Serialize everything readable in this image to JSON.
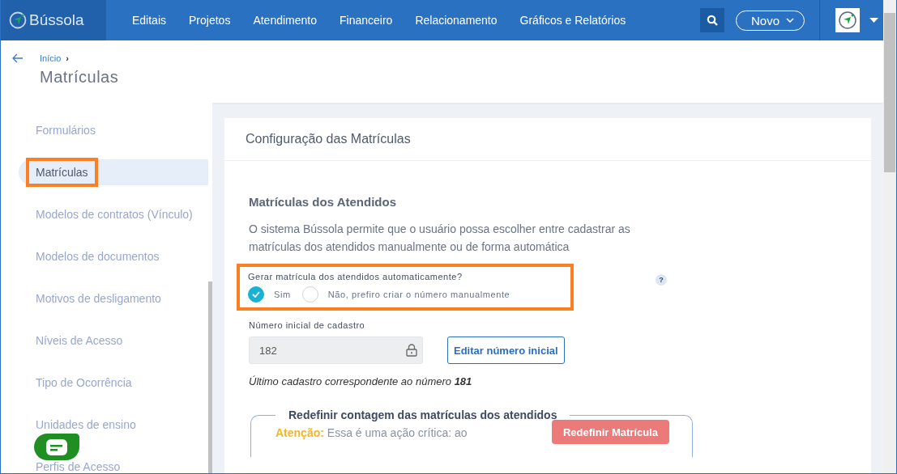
{
  "brand": "Bússola",
  "nav": [
    "Editais",
    "Projetos",
    "Atendimento",
    "Financeiro",
    "Relacionamento",
    "Gráficos e Relatórios"
  ],
  "new_button": "Novo",
  "breadcrumb": "Início",
  "breadcrumb_sep": "›",
  "page_title": "Matrículas",
  "sidebar": [
    {
      "label": "Formulários",
      "selected": false,
      "highlighted": false
    },
    {
      "label": "Matrículas",
      "selected": true,
      "highlighted": true
    },
    {
      "label": "Modelos de contratos (Vínculo)",
      "selected": false,
      "highlighted": false
    },
    {
      "label": "Modelos de documentos",
      "selected": false,
      "highlighted": false
    },
    {
      "label": "Motivos de desligamento",
      "selected": false,
      "highlighted": false
    },
    {
      "label": "Níveis de Acesso",
      "selected": false,
      "highlighted": false
    },
    {
      "label": "Tipo de Ocorrência",
      "selected": false,
      "highlighted": false
    },
    {
      "label": "Unidades de ensino",
      "selected": false,
      "highlighted": false
    },
    {
      "label": "Perfis de Acesso",
      "selected": false,
      "highlighted": false
    }
  ],
  "card_title": "Configuração das Matrículas",
  "section_title": "Matrículas dos Atendidos",
  "description": "O sistema Bússola permite que o usuário possa escolher entre cadastrar as matrículas dos atendidos manualmente ou de forma automática",
  "help": "?",
  "question": "Gerar matrícula dos atendidos automaticamente?",
  "options": [
    {
      "label": "Sim",
      "selected": true
    },
    {
      "label": "Não, prefiro criar o número manualmente",
      "selected": false
    }
  ],
  "start_label": "Número inicial de cadastro",
  "start_value": "182",
  "edit_button": "Editar número inicial",
  "last_note": "Último cadastro correspondente ao número **181**",
  "reset": {
    "title": "Redefinir contagem das matrículas dos atendidos",
    "warning_label": "Atenção:",
    "warning_text": "Essa é uma ação crítica: ao",
    "button": "Redefinir Matrícula"
  }
}
